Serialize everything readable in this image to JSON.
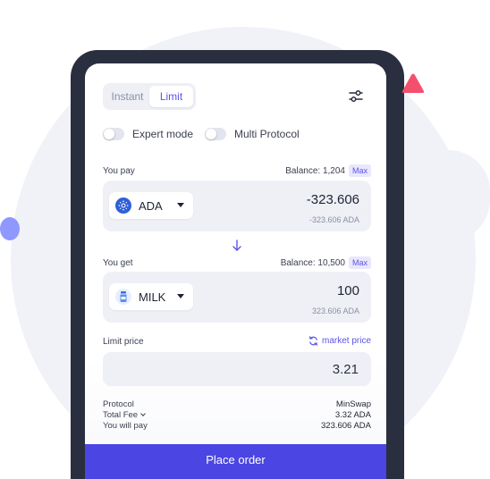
{
  "tabs": [
    {
      "label": "Instant",
      "active": false
    },
    {
      "label": "Limit",
      "active": true
    }
  ],
  "toggles": {
    "expert_mode": {
      "label": "Expert mode",
      "on": false
    },
    "multi_protocol": {
      "label": "Multi Protocol",
      "on": false
    }
  },
  "pay": {
    "label": "You pay",
    "balance": "Balance: 1,204",
    "max_label": "Max",
    "token": "ADA",
    "amount": "-323.606",
    "sub_amount": "-323.606 ADA"
  },
  "get": {
    "label": "You get",
    "balance": "Balance: 10,500",
    "max_label": "Max",
    "token": "MILK",
    "amount": "100",
    "sub_amount": "323.606 ADA"
  },
  "limit": {
    "label": "Limit price",
    "market_link": "market price",
    "value": "3.21"
  },
  "summary": {
    "protocol_label": "Protocol",
    "protocol_value": "MinSwap",
    "fee_label": "Total Fee",
    "fee_value": "3.32 ADA",
    "will_pay_label": "You will pay",
    "will_pay_value": "323.606 ADA"
  },
  "place_order_label": "Place order",
  "icons": {
    "settings": "sliders-icon",
    "ada": "ada-token-icon",
    "milk": "milk-token-icon",
    "swap": "arrow-down-icon",
    "refresh": "refresh-icon"
  },
  "colors": {
    "accent": "#5b54e8",
    "button": "#4b45e3",
    "input_bg": "#eef0f6",
    "frame": "#2a2f3f",
    "decor_pink": "#f4506e",
    "decor_blue": "#8e98ff"
  }
}
